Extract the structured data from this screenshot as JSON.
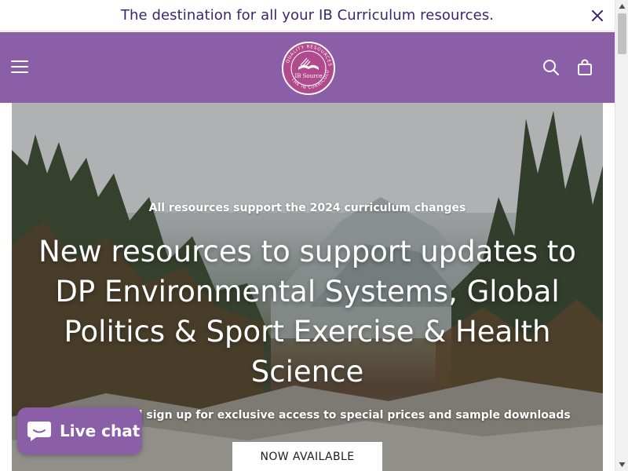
{
  "announcement": {
    "text": "The destination for all your IB Curriculum resources."
  },
  "header": {
    "logo_text": "IB Source",
    "logo_ring_text": "QUALITY RESOURCES FOR THE IB CURRICULUM"
  },
  "hero": {
    "eyebrow": "All resources support the 2024 curriculum changes",
    "title": "New resources to support updates to DP Environmental Systems, Global Politics & Sport Exercise & Health Science",
    "subtitle": "Order titles and sign up for exclusive access to special prices and sample downloads",
    "cta_label": "NOW AVAILABLE"
  },
  "live_chat": {
    "label": "Live chat"
  },
  "icons": {
    "close": "close-icon",
    "menu": "hamburger-menu-icon",
    "search": "search-icon",
    "cart": "shopping-bag-icon",
    "chat": "chat-bubble-icon"
  },
  "colors": {
    "brand_purple": "#8a5fa8",
    "announcement_text": "#3a2471",
    "cta_background": "#ffffff"
  }
}
